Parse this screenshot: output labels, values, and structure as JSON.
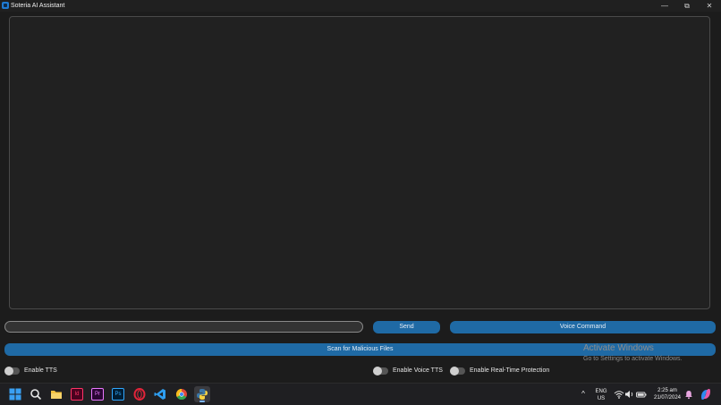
{
  "window": {
    "title": "Soteria AI Assistant",
    "minimize_glyph": "—",
    "maximize_glyph": "⧉",
    "close_glyph": "✕"
  },
  "chat": {
    "input_value": "",
    "input_placeholder": ""
  },
  "buttons": {
    "send": "Send",
    "voice_command": "Voice Command",
    "scan": "Scan for Malicious Files"
  },
  "toggles": {
    "tts": "Enable TTS",
    "voice_tts": "Enable Voice TTS",
    "realtime": "Enable Real-Time Protection"
  },
  "watermark": {
    "title": "Activate Windows",
    "subtitle": "Go to Settings to activate Windows."
  },
  "taskbar": {
    "apps": [
      "start-icon",
      "search-icon",
      "file-explorer-icon",
      "indesign-icon",
      "premiere-pro-icon",
      "photoshop-icon",
      "opera-icon",
      "vscode-icon",
      "chrome-icon",
      "python-app-icon"
    ],
    "indesign_letters": "Id",
    "premiere_letters": "Pr",
    "photoshop_letters": "Ps",
    "tray_chevron": "^",
    "lang": "ENG",
    "region": "US",
    "time": "2:25 am",
    "date": "21/07/2024"
  },
  "colors": {
    "accent": "#1f6aa5",
    "background": "#1c1c1c",
    "taskbar": "#1f1f22"
  }
}
